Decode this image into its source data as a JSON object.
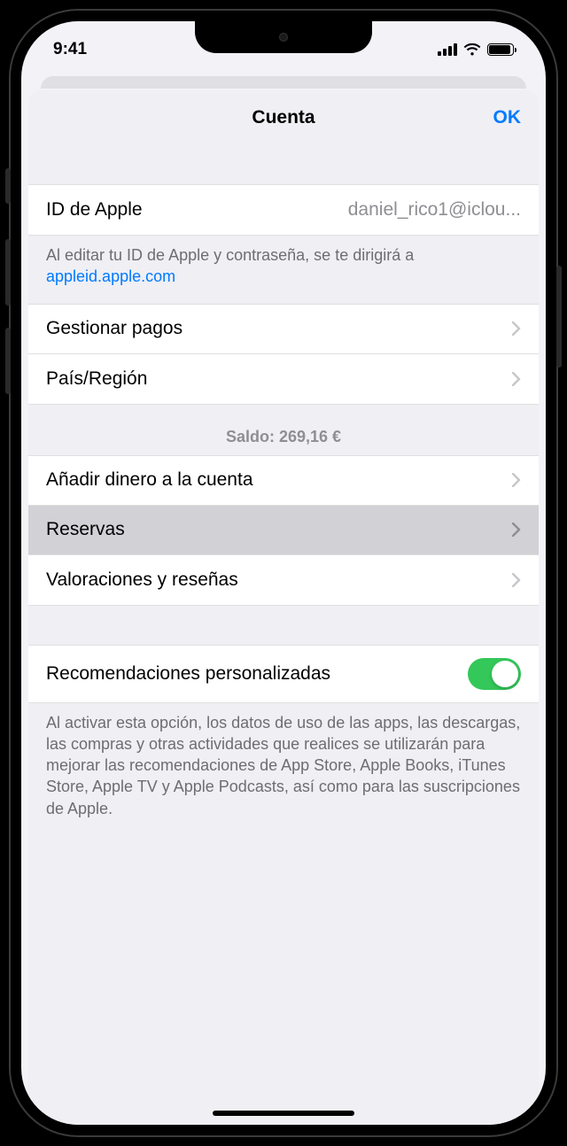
{
  "status": {
    "time": "9:41"
  },
  "modal": {
    "title": "Cuenta",
    "ok": "OK"
  },
  "apple_id": {
    "label": "ID de Apple",
    "value": "daniel_rico1@iclou...",
    "footer_prefix": "Al editar tu ID de Apple y contraseña, se te dirigirá a ",
    "footer_link": "appleid.apple.com"
  },
  "payments": {
    "manage": "Gestionar pagos",
    "region": "País/Región"
  },
  "balance": {
    "header": "Saldo: 269,16 €",
    "add_funds": "Añadir dinero a la cuenta",
    "preorders": "Reservas",
    "ratings": "Valoraciones y reseñas"
  },
  "recommendations": {
    "label": "Recomendaciones personalizadas",
    "enabled": true,
    "footer": "Al activar esta opción, los datos de uso de las apps, las descargas, las compras y otras actividades que realices se utilizarán para mejorar las recomendaciones de App Store, Apple Books, iTunes Store, Apple TV y Apple Podcasts, así como para las suscripciones de Apple."
  }
}
